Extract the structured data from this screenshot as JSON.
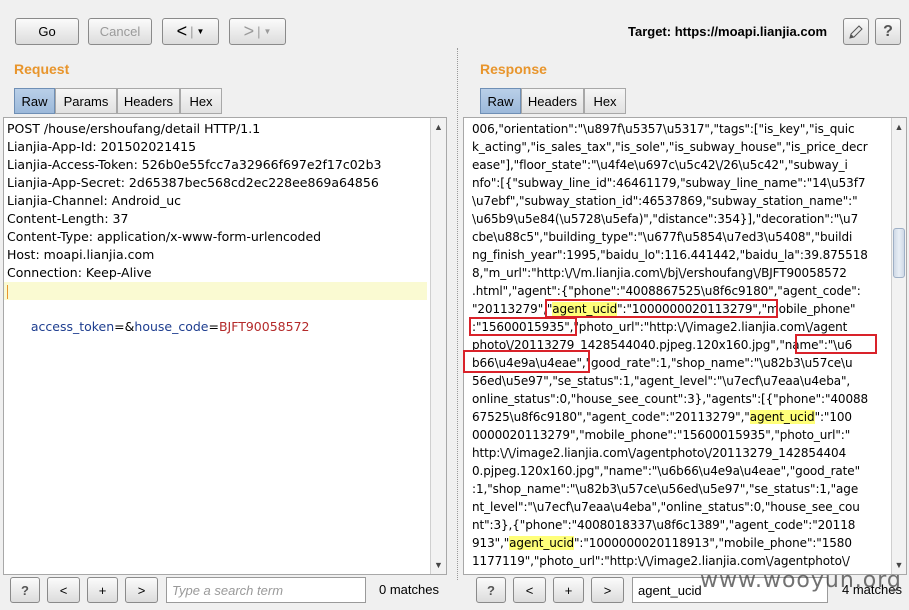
{
  "toolbar": {
    "go_label": "Go",
    "cancel_label": "Cancel",
    "back_arrow": "<",
    "forward_arrow": ">",
    "dropdown_glyph": "▼",
    "target_text": "Target: https://moapi.lianjia.com",
    "help_label": "?"
  },
  "request": {
    "title": "Request",
    "tabs": [
      "Raw",
      "Params",
      "Headers",
      "Hex"
    ],
    "active_tab": "Raw",
    "lines": [
      "POST /house/ershoufang/detail HTTP/1.1",
      "Lianjia-App-Id: 201502021415",
      "Lianjia-Access-Token: 526b0e55fcc7a32966f697e2f17c02b3",
      "Lianjia-App-Secret: 2d65387bec568cd2ec228ee869a64856",
      "Lianjia-Channel: Android_uc",
      "Content-Length: 37",
      "Content-Type: application/x-www-form-urlencoded",
      "Host: moapi.lianjia.com",
      "Connection: Keep-Alive",
      ""
    ],
    "body": {
      "p1": "access_token",
      "eq1": "=",
      "amp": "&",
      "p2": "house_code",
      "eq2": "=",
      "v2": "BJFT90058572"
    },
    "search": {
      "placeholder": "Type a search term",
      "value": "",
      "matches": "0 matches"
    }
  },
  "response": {
    "title": "Response",
    "tabs": [
      "Raw",
      "Headers",
      "Hex"
    ],
    "active_tab": "Raw",
    "lines": [
      "006,\"orientation\":\"\\u897f\\u5357\\u5317\",\"tags\":[\"is_key\",\"is_quic",
      "k_acting\",\"is_sales_tax\",\"is_sole\",\"is_subway_house\",\"is_price_decr",
      "ease\"],\"floor_state\":\"\\u4f4e\\u697c\\u5c42\\/26\\u5c42\",\"subway_i",
      "nfo\":[{\"subway_line_id\":46461179,\"subway_line_name\":\"14\\u53f7",
      "\\u7ebf\",\"subway_station_id\":46537869,\"subway_station_name\":\"",
      "\\u65b9\\u5e84(\\u5728\\u5efa)\",\"distance\":354}],\"decoration\":\"\\u7",
      "cbe\\u88c5\",\"building_type\":\"\\u677f\\u5854\\u7ed3\\u5408\",\"buildi",
      "ng_finish_year\":1995,\"baidu_lo\":116.441442,\"baidu_la\":39.875518",
      "8,\"m_url\":\"http:\\/\\/m.lianjia.com\\/bj\\/ershoufang\\/BJFT90058572",
      ".html\",\"agent\":{\"phone\":\"4008867525\\u8f6c9180\",\"agent_code\":",
      "\"20113279\",\"agent_ucid\":\"1000000020113279\",\"mobile_phone\"",
      ":\"15600015935\",\"photo_url\":\"http:\\/\\/image2.lianjia.com\\/agent",
      "photo\\/20113279_1428544040.pjpeg.120x160.jpg\",\"name\":\"\\u6",
      "b66\\u4e9a\\u4eae\",\"good_rate\":1,\"shop_name\":\"\\u82b3\\u57ce\\u",
      "56ed\\u5e97\",\"se_status\":1,\"agent_level\":\"\\u7ecf\\u7eaa\\u4eba\",",
      "online_status\":0,\"house_see_count\":3},\"agents\":[{\"phone\":\"40088",
      "67525\\u8f6c9180\",\"agent_code\":\"20113279\",\"agent_ucid\":\"100",
      "0000020113279\",\"mobile_phone\":\"15600015935\",\"photo_url\":\"",
      "http:\\/\\/image2.lianjia.com\\/agentphoto\\/20113279_142854404",
      "0.pjpeg.120x160.jpg\",\"name\":\"\\u6b66\\u4e9a\\u4eae\",\"good_rate\"",
      ":1,\"shop_name\":\"\\u82b3\\u57ce\\u56ed\\u5e97\",\"se_status\":1,\"age",
      "nt_level\":\"\\u7ecf\\u7eaa\\u4eba\",\"online_status\":0,\"house_see_cou",
      "nt\":3},{\"phone\":\"4008018337\\u8f6c1389\",\"agent_code\":\"20118",
      "913\",\"agent_ucid\":\"1000000020118913\",\"mobile_phone\":\"1580",
      "1177119\",\"photo_url\":\"http:\\/\\/image2.lianjia.com\\/agentphoto\\/"
    ],
    "highlight_term": "agent_ucid",
    "search": {
      "value": "agent_ucid",
      "matches": "4 matches"
    }
  },
  "nav": {
    "help": "?",
    "prev": "<",
    "add": "+",
    "next": ">"
  },
  "watermark": "www.wooyun.org"
}
